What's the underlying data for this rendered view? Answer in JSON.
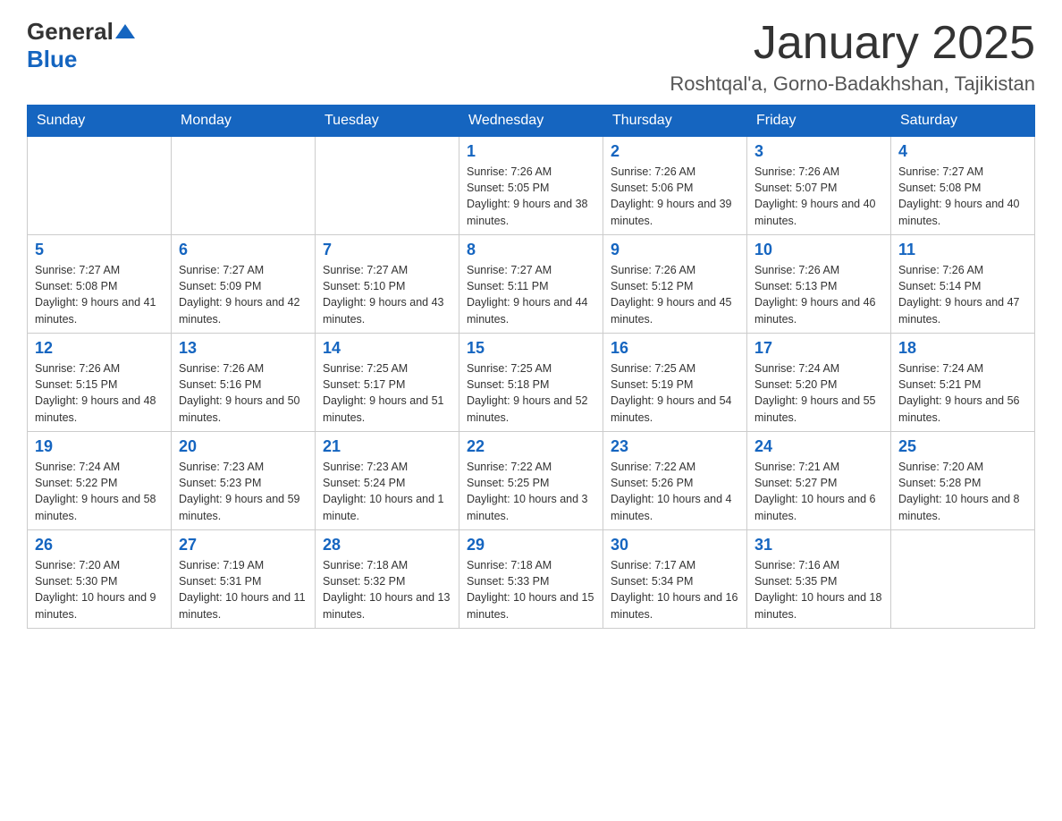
{
  "logo": {
    "general": "General",
    "blue": "Blue"
  },
  "title": {
    "month_year": "January 2025",
    "location": "Roshtqal'a, Gorno-Badakhshan, Tajikistan"
  },
  "headers": [
    "Sunday",
    "Monday",
    "Tuesday",
    "Wednesday",
    "Thursday",
    "Friday",
    "Saturday"
  ],
  "weeks": [
    [
      {
        "day": "",
        "info": ""
      },
      {
        "day": "",
        "info": ""
      },
      {
        "day": "",
        "info": ""
      },
      {
        "day": "1",
        "info": "Sunrise: 7:26 AM\nSunset: 5:05 PM\nDaylight: 9 hours and 38 minutes."
      },
      {
        "day": "2",
        "info": "Sunrise: 7:26 AM\nSunset: 5:06 PM\nDaylight: 9 hours and 39 minutes."
      },
      {
        "day": "3",
        "info": "Sunrise: 7:26 AM\nSunset: 5:07 PM\nDaylight: 9 hours and 40 minutes."
      },
      {
        "day": "4",
        "info": "Sunrise: 7:27 AM\nSunset: 5:08 PM\nDaylight: 9 hours and 40 minutes."
      }
    ],
    [
      {
        "day": "5",
        "info": "Sunrise: 7:27 AM\nSunset: 5:08 PM\nDaylight: 9 hours and 41 minutes."
      },
      {
        "day": "6",
        "info": "Sunrise: 7:27 AM\nSunset: 5:09 PM\nDaylight: 9 hours and 42 minutes."
      },
      {
        "day": "7",
        "info": "Sunrise: 7:27 AM\nSunset: 5:10 PM\nDaylight: 9 hours and 43 minutes."
      },
      {
        "day": "8",
        "info": "Sunrise: 7:27 AM\nSunset: 5:11 PM\nDaylight: 9 hours and 44 minutes."
      },
      {
        "day": "9",
        "info": "Sunrise: 7:26 AM\nSunset: 5:12 PM\nDaylight: 9 hours and 45 minutes."
      },
      {
        "day": "10",
        "info": "Sunrise: 7:26 AM\nSunset: 5:13 PM\nDaylight: 9 hours and 46 minutes."
      },
      {
        "day": "11",
        "info": "Sunrise: 7:26 AM\nSunset: 5:14 PM\nDaylight: 9 hours and 47 minutes."
      }
    ],
    [
      {
        "day": "12",
        "info": "Sunrise: 7:26 AM\nSunset: 5:15 PM\nDaylight: 9 hours and 48 minutes."
      },
      {
        "day": "13",
        "info": "Sunrise: 7:26 AM\nSunset: 5:16 PM\nDaylight: 9 hours and 50 minutes."
      },
      {
        "day": "14",
        "info": "Sunrise: 7:25 AM\nSunset: 5:17 PM\nDaylight: 9 hours and 51 minutes."
      },
      {
        "day": "15",
        "info": "Sunrise: 7:25 AM\nSunset: 5:18 PM\nDaylight: 9 hours and 52 minutes."
      },
      {
        "day": "16",
        "info": "Sunrise: 7:25 AM\nSunset: 5:19 PM\nDaylight: 9 hours and 54 minutes."
      },
      {
        "day": "17",
        "info": "Sunrise: 7:24 AM\nSunset: 5:20 PM\nDaylight: 9 hours and 55 minutes."
      },
      {
        "day": "18",
        "info": "Sunrise: 7:24 AM\nSunset: 5:21 PM\nDaylight: 9 hours and 56 minutes."
      }
    ],
    [
      {
        "day": "19",
        "info": "Sunrise: 7:24 AM\nSunset: 5:22 PM\nDaylight: 9 hours and 58 minutes."
      },
      {
        "day": "20",
        "info": "Sunrise: 7:23 AM\nSunset: 5:23 PM\nDaylight: 9 hours and 59 minutes."
      },
      {
        "day": "21",
        "info": "Sunrise: 7:23 AM\nSunset: 5:24 PM\nDaylight: 10 hours and 1 minute."
      },
      {
        "day": "22",
        "info": "Sunrise: 7:22 AM\nSunset: 5:25 PM\nDaylight: 10 hours and 3 minutes."
      },
      {
        "day": "23",
        "info": "Sunrise: 7:22 AM\nSunset: 5:26 PM\nDaylight: 10 hours and 4 minutes."
      },
      {
        "day": "24",
        "info": "Sunrise: 7:21 AM\nSunset: 5:27 PM\nDaylight: 10 hours and 6 minutes."
      },
      {
        "day": "25",
        "info": "Sunrise: 7:20 AM\nSunset: 5:28 PM\nDaylight: 10 hours and 8 minutes."
      }
    ],
    [
      {
        "day": "26",
        "info": "Sunrise: 7:20 AM\nSunset: 5:30 PM\nDaylight: 10 hours and 9 minutes."
      },
      {
        "day": "27",
        "info": "Sunrise: 7:19 AM\nSunset: 5:31 PM\nDaylight: 10 hours and 11 minutes."
      },
      {
        "day": "28",
        "info": "Sunrise: 7:18 AM\nSunset: 5:32 PM\nDaylight: 10 hours and 13 minutes."
      },
      {
        "day": "29",
        "info": "Sunrise: 7:18 AM\nSunset: 5:33 PM\nDaylight: 10 hours and 15 minutes."
      },
      {
        "day": "30",
        "info": "Sunrise: 7:17 AM\nSunset: 5:34 PM\nDaylight: 10 hours and 16 minutes."
      },
      {
        "day": "31",
        "info": "Sunrise: 7:16 AM\nSunset: 5:35 PM\nDaylight: 10 hours and 18 minutes."
      },
      {
        "day": "",
        "info": ""
      }
    ]
  ]
}
